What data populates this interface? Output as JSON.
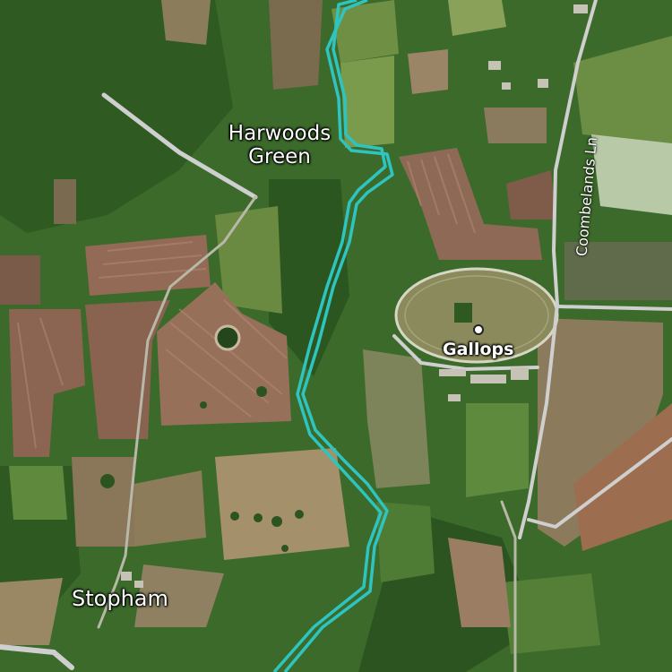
{
  "map": {
    "type": "satellite",
    "places": {
      "harwoods_green_line1": "Harwoods",
      "harwoods_green_line2": "Green",
      "stopham": "Stopham",
      "gallops": "Gallops"
    },
    "roads": {
      "coombelands_lane": "Coombelands Ln"
    },
    "colors": {
      "river_route": "#2ec4c0",
      "road": "#d9d9d9",
      "woodland": "#2f5a22",
      "pasture": "#6f8f45",
      "ploughed_field": "#8a6a52",
      "racecourse": "#8c8e5e"
    }
  }
}
